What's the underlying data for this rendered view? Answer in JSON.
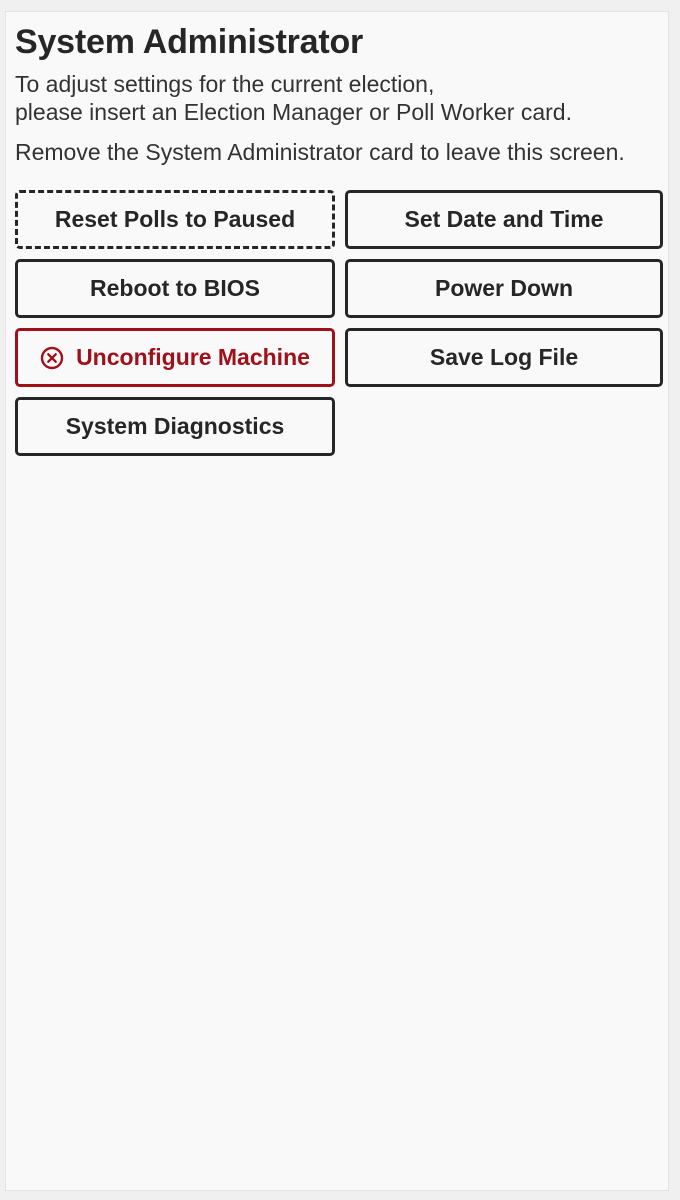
{
  "screen": {
    "title": "System Administrator",
    "instructions_line1": "To adjust settings for the current election,",
    "instructions_line2": "please insert an Election Manager or Poll Worker card.",
    "remove_card_text": "Remove the System Administrator card to leave this screen."
  },
  "buttons": {
    "reset_polls": "Reset Polls to Paused",
    "set_date_time": "Set Date and Time",
    "reboot_bios": "Reboot to BIOS",
    "power_down": "Power Down",
    "unconfigure": "Unconfigure Machine",
    "save_log": "Save Log File",
    "diagnostics": "System Diagnostics"
  },
  "icons": {
    "unconfigure_icon": "circle-x-icon"
  },
  "colors": {
    "danger": "#a0101b",
    "text": "#262626",
    "background": "#f9f9f9"
  }
}
